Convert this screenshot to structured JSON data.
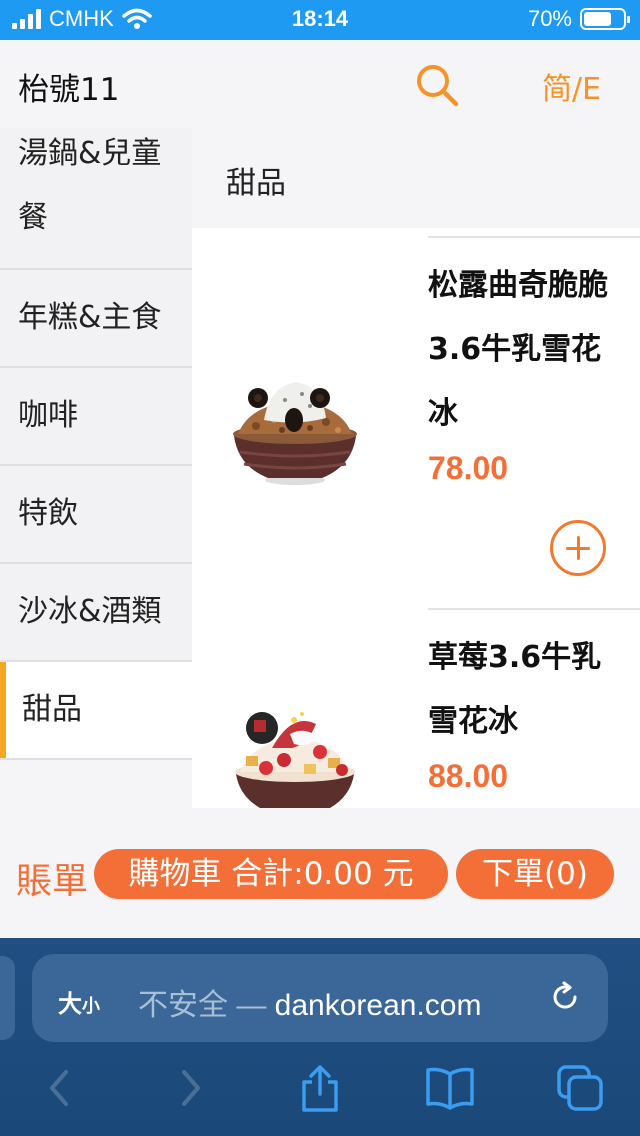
{
  "status_bar": {
    "carrier": "CMHK",
    "time": "18:14",
    "battery": "70%",
    "battery_level": 0.7
  },
  "header": {
    "store_name": "枱號11",
    "language_toggle": "简/E"
  },
  "sidebar": {
    "categories": [
      {
        "label": "湯鍋&兒童餐",
        "active": false
      },
      {
        "label": "年糕&主食",
        "active": false
      },
      {
        "label": "咖啡",
        "active": false
      },
      {
        "label": "特飲",
        "active": false
      },
      {
        "label": "沙冰&酒類",
        "active": false
      },
      {
        "label": "甜品",
        "active": true
      }
    ]
  },
  "content": {
    "section_title": "甜品",
    "products": [
      {
        "name": "松露曲奇脆脆3.6牛乳雪花冰",
        "price": "78.00"
      },
      {
        "name": "草莓3.6牛乳雪花冰",
        "price": "88.00"
      }
    ]
  },
  "cart_bar": {
    "bill_label": "賬單",
    "cart_label": "購物車 合計:0.00 元",
    "order_label": "下單(0)"
  },
  "browser": {
    "text_size_big": "大",
    "text_size_small": "小",
    "insecure_label": "不安全 — ",
    "domain": "dankorean.com"
  },
  "colors": {
    "accent_orange": "#f36f37",
    "icon_orange": "#f5932a",
    "active_indicator": "#f5a623",
    "status_bar_blue": "#1e9af2",
    "browser_bar_blue": "#1a4878"
  },
  "icons": [
    "wifi-icon",
    "search-icon",
    "plus-circle-icon",
    "reload-icon",
    "back-icon",
    "forward-icon",
    "share-icon",
    "bookmarks-icon",
    "tabs-icon"
  ]
}
